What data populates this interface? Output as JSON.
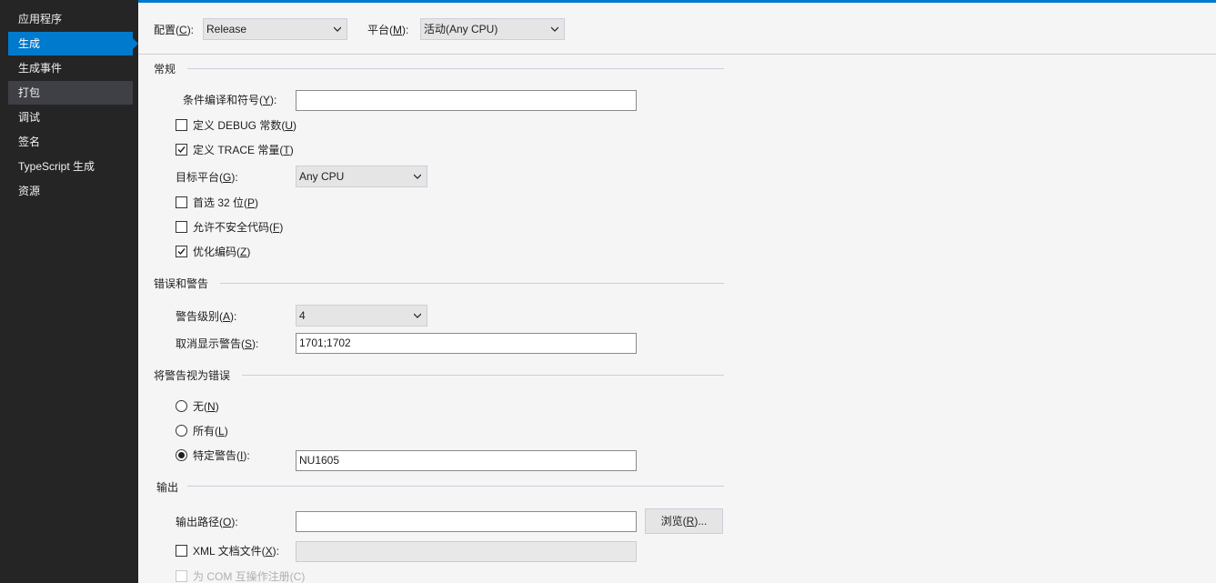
{
  "sidebar": {
    "items": [
      {
        "label": "应用程序"
      },
      {
        "label": "生成"
      },
      {
        "label": "生成事件"
      },
      {
        "label": "打包"
      },
      {
        "label": "调试"
      },
      {
        "label": "签名"
      },
      {
        "label": "TypeScript 生成"
      },
      {
        "label": "资源"
      }
    ],
    "selected": "生成",
    "hovered": "打包"
  },
  "toolbar": {
    "config_label": "配置",
    "config_key": "C",
    "config_value": "Release",
    "platform_label": "平台",
    "platform_key": "M",
    "platform_value": "活动(Any CPU)"
  },
  "general": {
    "title": "常规",
    "conditional_symbols_label": "条件编译和符号",
    "conditional_symbols_key": "Y",
    "conditional_symbols_value": "",
    "define_debug_label": "定义 DEBUG 常数",
    "define_debug_key": "U",
    "define_debug_checked": false,
    "define_trace_label": "定义 TRACE 常量",
    "define_trace_key": "T",
    "define_trace_checked": true,
    "target_platform_label": "目标平台",
    "target_platform_key": "G",
    "target_platform_value": "Any CPU",
    "prefer32_label": "首选 32 位",
    "prefer32_key": "P",
    "prefer32_checked": false,
    "unsafe_label": "允许不安全代码",
    "unsafe_key": "F",
    "unsafe_checked": false,
    "optimize_label": "优化编码",
    "optimize_key": "Z",
    "optimize_checked": true
  },
  "errors": {
    "title": "错误和警告",
    "warning_level_label": "警告级别",
    "warning_level_key": "A",
    "warning_level_value": "4",
    "suppress_label": "取消显示警告",
    "suppress_key": "S",
    "suppress_value": "1701;1702"
  },
  "treat_warnings": {
    "title": "将警告视为错误",
    "none_label": "无",
    "none_key": "N",
    "all_label": "所有",
    "all_key": "L",
    "specific_label": "特定警告",
    "specific_key": "I",
    "specific_value": "NU1605",
    "selected": "specific"
  },
  "output": {
    "title": "输出",
    "path_label": "输出路径",
    "path_key": "O",
    "path_value": "",
    "browse_label": "浏览",
    "browse_key": "R",
    "xml_doc_label": "XML 文档文件",
    "xml_doc_key": "X",
    "xml_doc_checked": false,
    "xml_doc_value": "",
    "com_interop_label": "为 COM 互操作注册(C)"
  },
  "colors": {
    "accent": "#007acc",
    "sidebar_bg": "#252526",
    "main_bg": "#f5f5f5"
  }
}
